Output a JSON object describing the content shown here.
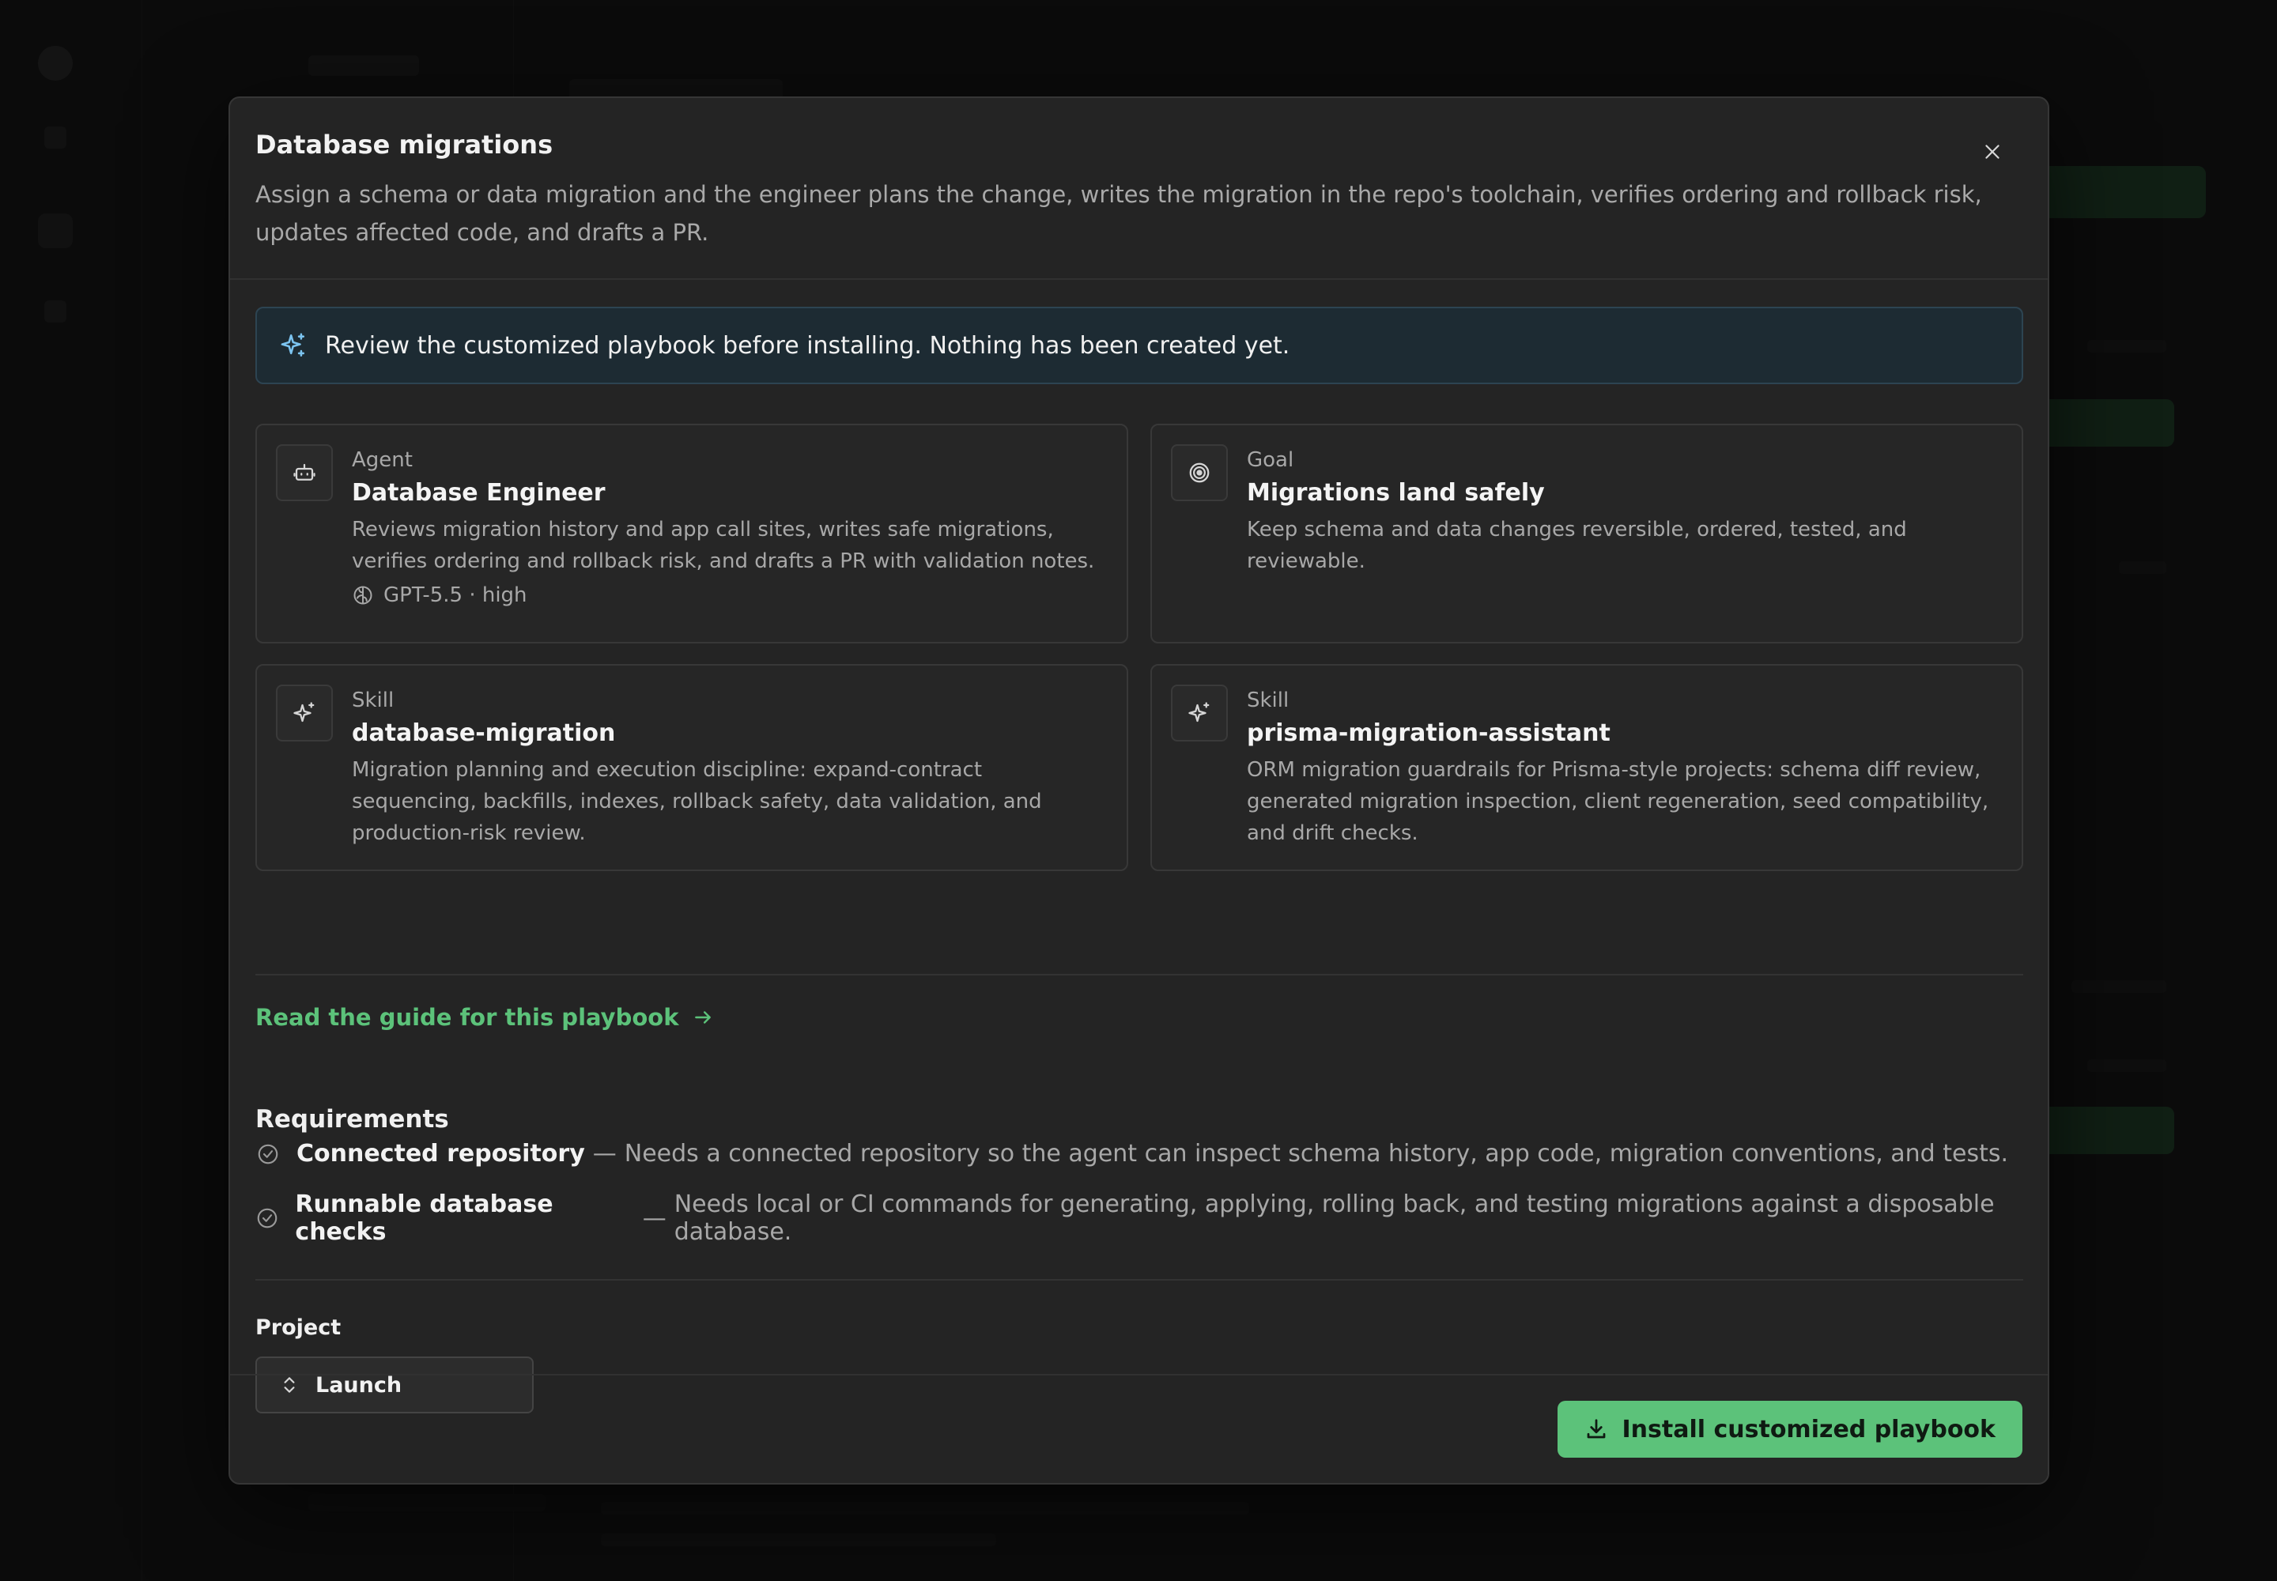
{
  "modal": {
    "title": "Database migrations",
    "description": "Assign a schema or data migration and the engineer plans the change, writes the migration in the repo's toolchain, verifies ordering and rollback risk, updates affected code, and drafts a PR."
  },
  "notice": {
    "icon": "sparkle-icon",
    "text": "Review the customized playbook before installing. Nothing has been created yet."
  },
  "cards": [
    {
      "kind": "Agent",
      "icon": "robot-icon",
      "name": "Database Engineer",
      "description": "Reviews migration history and app call sites, writes safe migrations, verifies ordering and rollback risk, and drafts a PR with validation notes.",
      "meta": "GPT-5.5 · high"
    },
    {
      "kind": "Goal",
      "icon": "target-icon",
      "name": "Migrations land safely",
      "description": "Keep schema and data changes reversible, ordered, tested, and reviewable."
    },
    {
      "kind": "Skill",
      "icon": "sparkle-icon",
      "name": "database-migration",
      "description": "Migration planning and execution discipline: expand-contract sequencing, backfills, indexes, rollback safety, data validation, and production-risk review."
    },
    {
      "kind": "Skill",
      "icon": "sparkle-icon",
      "name": "prisma-migration-assistant",
      "description": "ORM migration guardrails for Prisma-style projects: schema diff review, generated migration inspection, client regeneration, seed compatibility, and drift checks."
    }
  ],
  "guide_link": "Read the guide for this playbook",
  "requirements": {
    "title": "Requirements",
    "items": [
      {
        "name": "Connected repository",
        "separator": "—",
        "description": "Needs a connected repository so the agent can inspect schema history, app code, migration conventions, and tests."
      },
      {
        "name": "Runnable database checks",
        "separator": "—",
        "description": "Needs local or CI commands for generating, applying, rolling back, and testing migrations against a disposable database."
      }
    ]
  },
  "project": {
    "label": "Project",
    "value": "Launch"
  },
  "footer": {
    "install_label": "Install customized playbook"
  },
  "colors": {
    "accent": "#5cc27a",
    "notice_bg": "#1d2b33",
    "modal_bg": "#242424"
  }
}
